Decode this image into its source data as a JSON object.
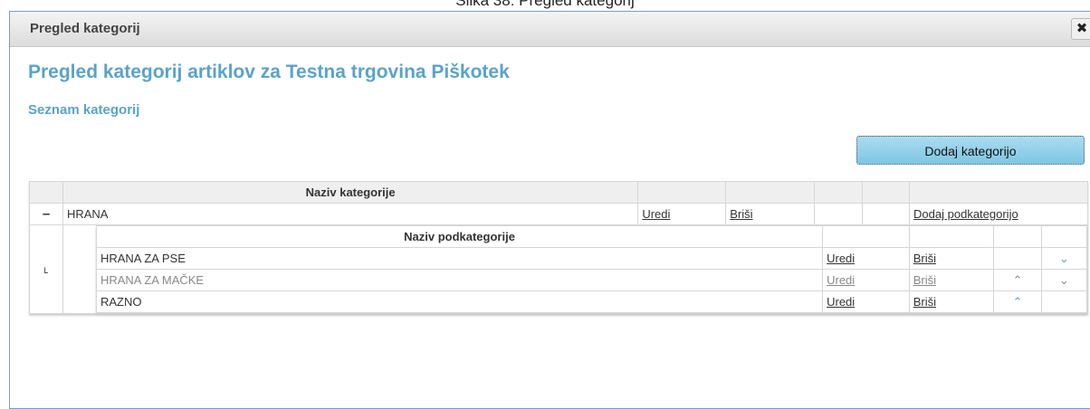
{
  "caption": "Slika 38: Pregled kategorij",
  "window": {
    "title": "Pregled kategorij",
    "close_icon": "close-icon"
  },
  "heading": "Pregled kategorij artiklov za Testna trgovina Piškotek",
  "subheading": "Seznam kategorij",
  "add_category_label": "Dodaj kategorijo",
  "categories_header": "Naziv kategorije",
  "category": {
    "toggle": "–",
    "name": "HRANA",
    "edit": "Uredi",
    "delete": "Briši",
    "add_sub": "Dodaj podkategorijo"
  },
  "subcategories_header": "Naziv podkategorije",
  "sub_marker": "˪",
  "subcategories": [
    {
      "name": "HRANA ZA PSE",
      "edit": "Uredi",
      "delete": "Briši",
      "up": "",
      "down": "⌄"
    },
    {
      "name": "HRANA ZA MAČKE",
      "edit": "Uredi",
      "delete": "Briši",
      "up": "⌃",
      "down": "⌄"
    },
    {
      "name": "RAZNO",
      "edit": "Uredi",
      "delete": "Briši",
      "up": "⌃",
      "down": ""
    }
  ]
}
